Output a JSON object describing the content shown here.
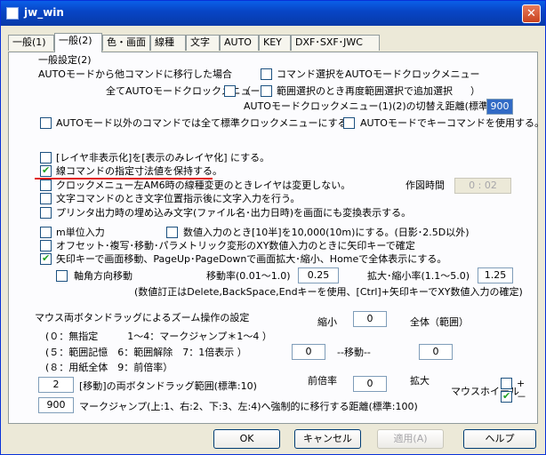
{
  "window": {
    "title": "jw_win",
    "close_glyph": "✕",
    "icon": "app-icon"
  },
  "tabs": [
    {
      "label": "一般(1)"
    },
    {
      "label": "一般(2)"
    },
    {
      "label": "色・画面"
    },
    {
      "label": "線種"
    },
    {
      "label": "文字"
    },
    {
      "label": "AUTO"
    },
    {
      "label": "KEY"
    },
    {
      "label": "DXF･SXF･JWC"
    }
  ],
  "section_title": "一般設定(2)",
  "auto": {
    "header": "AUTOモードから他コマンドに移行した場合",
    "cmd_select": "コマンド選択をAUTOモードクロックメニュー",
    "all_auto": "全てAUTOモードクロックメニュー",
    "paren_open": "（",
    "range_select": "範囲選択のとき再度範囲選択で追加選択",
    "paren_close": "）",
    "switch_distance": "AUTOモードクロックメニュー(1)(2)の切替え距離(標準:100)",
    "switch_distance_value": "900",
    "non_auto_std": "AUTOモード以外のコマンドでは全て標準クロックメニューにする。",
    "auto_key_cmd": "AUTOモードでキーコマンドを使用する。"
  },
  "options": {
    "layer_hidden": "[レイヤ非表示化]を[表示のみレイヤ化] にする。",
    "keep_line_dim": "線コマンドの指定寸法値を保持する。",
    "clock_am6": "クロックメニュー左AM6時の線種変更のときレイヤは変更しない。",
    "drawing_time_label": "作図時間",
    "drawing_time_value": "0 : 02",
    "text_cmd_input": "文字コマンドのとき文字位置指示後に文字入力を行う。",
    "printer_embed": "プリンタ出力時の埋め込み文字(ファイル名･出力日時)を画面にも変換表示する。",
    "m_unit": "m単位入力",
    "num_input_10": "数値入力のとき[10半]を10,000(10m)にする。(日影･2.5D以外)",
    "offset_xy": "オフセット･複写･移動･パラメトリック変形のXY数値入力のときに矢印キーで確定",
    "arrow_keys": "矢印キーで画面移動、PageUp･PageDownで画面拡大･縮小、Homeで全体表示にする。",
    "axis_move": "軸角方向移動",
    "move_rate_label": "移動率(0.01～1.0)",
    "move_rate_value": "0.25",
    "zoom_rate_label": "拡大･縮小率(1.1～5.0)",
    "zoom_rate_value": "1.25",
    "numeric_edit_note": "(数値訂正はDelete,BackSpace,Endキーを使用、[Ctrl]+矢印キーでXY数値入力の確定)"
  },
  "zoom": {
    "header": "マウス両ボタンドラッグによるズーム操作の設定",
    "legend1": "(０：無指定　　　1～4：マークジャンプ＊1～4 ）",
    "legend2": "(５：範囲記憶　6：範囲解除　7：1倍表示 ）",
    "legend3": "(８：用紙全体　9：前倍率）",
    "shrink_label": "縮小",
    "shrink_value": "0",
    "whole_label": "全体（範囲）",
    "move_label": "--移動--",
    "move_left_value": "0",
    "move_right_value": "0",
    "prev_label": "前倍率",
    "prev_value": "0",
    "expand_label": "拡大",
    "drag_range_value": "2",
    "drag_range_label": "[移動]の両ボタンドラッグ範囲(標準:10)",
    "mark_jump_value": "900",
    "mark_jump_label": "マークジャンプ(上:1、右:2、下:3、左:4)へ強制的に移行する距離(標準:100)",
    "wheel_label": "マウスホイール",
    "wheel_plus": "+",
    "wheel_minus": "－"
  },
  "buttons": {
    "ok": "OK",
    "cancel": "キャンセル",
    "apply": "適用(A)",
    "help": "ヘルプ"
  }
}
